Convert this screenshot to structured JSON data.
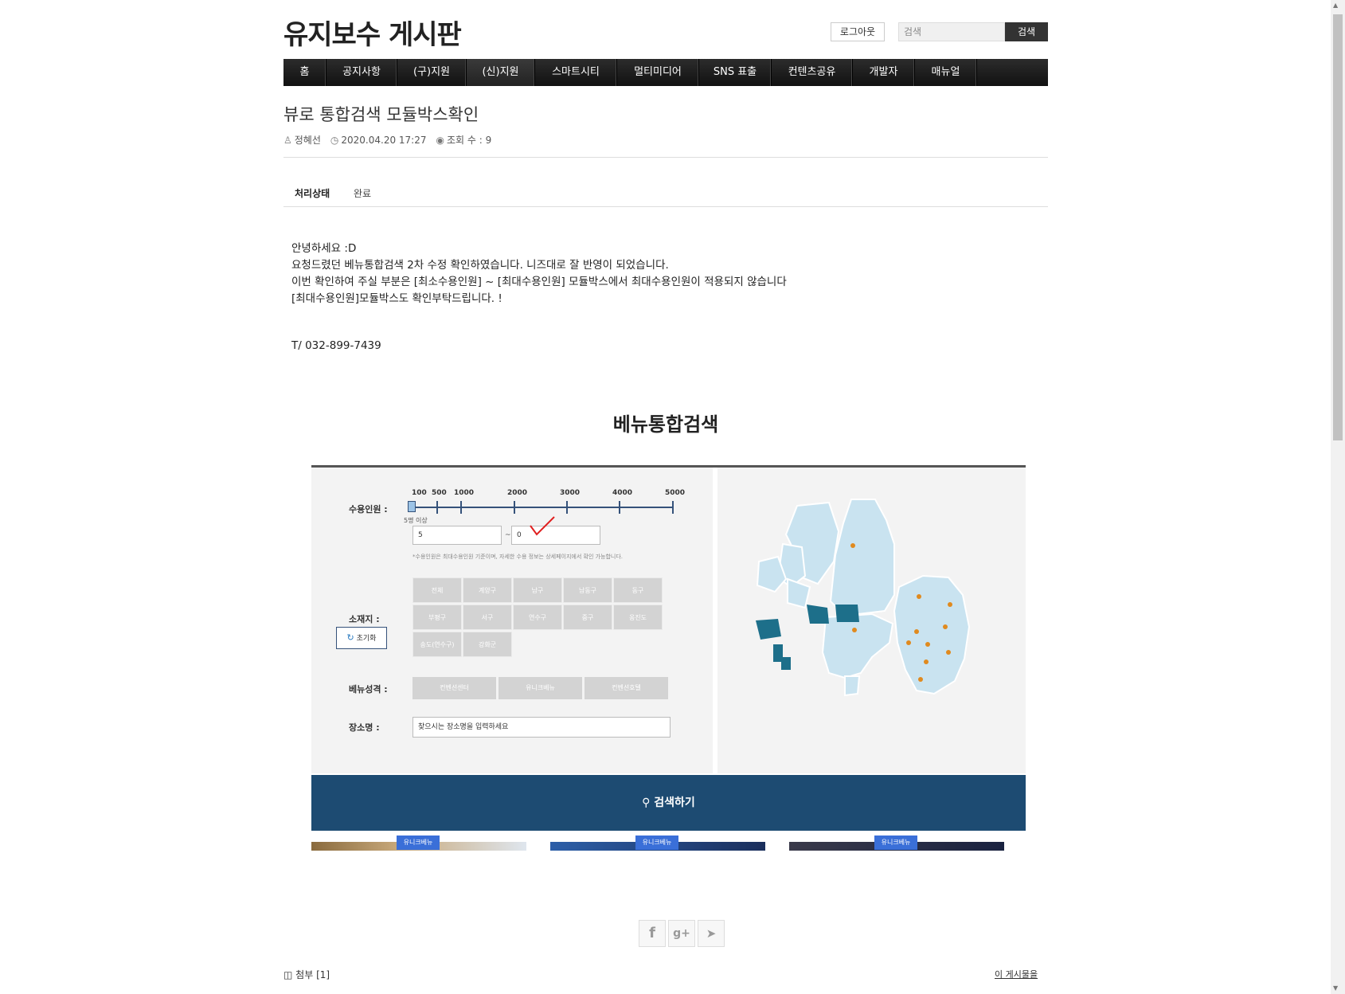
{
  "header": {
    "site_title": "유지보수 게시판",
    "logout_label": "로그아웃",
    "search_placeholder": "검색",
    "search_button": "검색"
  },
  "nav": {
    "items": [
      {
        "label": "홈"
      },
      {
        "label": "공지사항"
      },
      {
        "label": "(구)지원"
      },
      {
        "label": "(신)지원"
      },
      {
        "label": "스마트시티"
      },
      {
        "label": "멀티미디어"
      },
      {
        "label": "SNS 표출"
      },
      {
        "label": "컨텐츠공유"
      },
      {
        "label": "개발자"
      },
      {
        "label": "매뉴얼"
      }
    ],
    "active_index": 3
  },
  "post": {
    "title": "뷰로 통합검색 모듈박스확인",
    "author": "정혜선",
    "datetime": "2020.04.20 17:27",
    "views": "조회 수 : 9",
    "status_label": "처리상태",
    "status_value": "완료",
    "body": [
      "안녕하세요 :D",
      "요청드렸던 베뉴통합검색 2차 수정 확인하였습니다. 니즈대로 잘 반영이 되었습니다.",
      "이번 확인하여 주실 부분은 [최소수용인원] ~ [최대수용인원] 모듈박스에서 최대수용인원이 적용되지 않습니다",
      "[최대수용인원]모듈박스도 확인부탁드립니다. !"
    ],
    "phone": "T/ 032-899-7439"
  },
  "embedded": {
    "title": "베뉴통합검색",
    "capacity_label": "수용인원 :",
    "scale_numbers": [
      "100",
      "500",
      "1000",
      "2000",
      "3000",
      "4000",
      "5000"
    ],
    "min_caption": "5명 이상",
    "min_value": "5",
    "max_value": "0",
    "tilde": "~",
    "note": "*수용인원은 최대수용인원 기준이며, 자세한 수용 정보는 상세페이지에서 확인 가능합니다.",
    "location_label": "소재지 :",
    "reset_label": "초기화",
    "regions": [
      "전체",
      "계양구",
      "남구",
      "남동구",
      "동구",
      "부평구",
      "서구",
      "연수구",
      "중구",
      "옹진도",
      "송도(연수구)",
      "강화군"
    ],
    "venue_type_label": "베뉴성격 :",
    "venue_types": [
      "컨벤션센터",
      "유니크베뉴",
      "컨벤션호텔"
    ],
    "place_label": "장소명 :",
    "place_placeholder": "찾으시는 장소명을 입력하세요",
    "search_button": "검색하기",
    "thumb_tags": [
      "유니크베뉴",
      "유니크베뉴",
      "유니크베뉴"
    ]
  },
  "footer": {
    "attach": "첨부 [1]",
    "permalink": "이 게시물을"
  },
  "colors": {
    "nav_bg": "#1a1a1a",
    "accent_navy": "#1d4b72",
    "map_fill": "#c9e3f0"
  }
}
